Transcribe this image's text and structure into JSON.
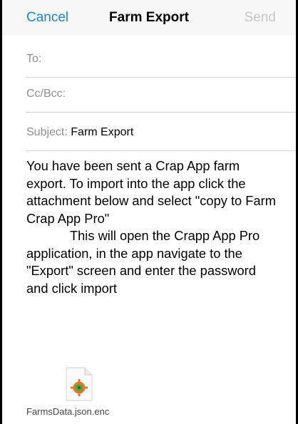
{
  "nav": {
    "cancel_label": "Cancel",
    "title": "Farm Export",
    "send_label": "Send"
  },
  "fields": {
    "to_label": "To:",
    "cc_label": "Cc/Bcc:",
    "subject_label": "Subject:",
    "subject_value": "Farm Export"
  },
  "body": {
    "text": "You have been sent a Crap App farm export. To import into the app click the attachment below and select \"copy to Farm Crap App Pro\"\n            This will open the Crapp App Pro application, in the app navigate to the \"Export\" screen and enter the password and click import"
  },
  "attachment": {
    "filename": "FarmsData.json.enc",
    "icon": "file-attachment-icon"
  },
  "colors": {
    "accent": "#1a82e2",
    "disabled": "#c7c7cc",
    "label": "#8e8e93"
  }
}
